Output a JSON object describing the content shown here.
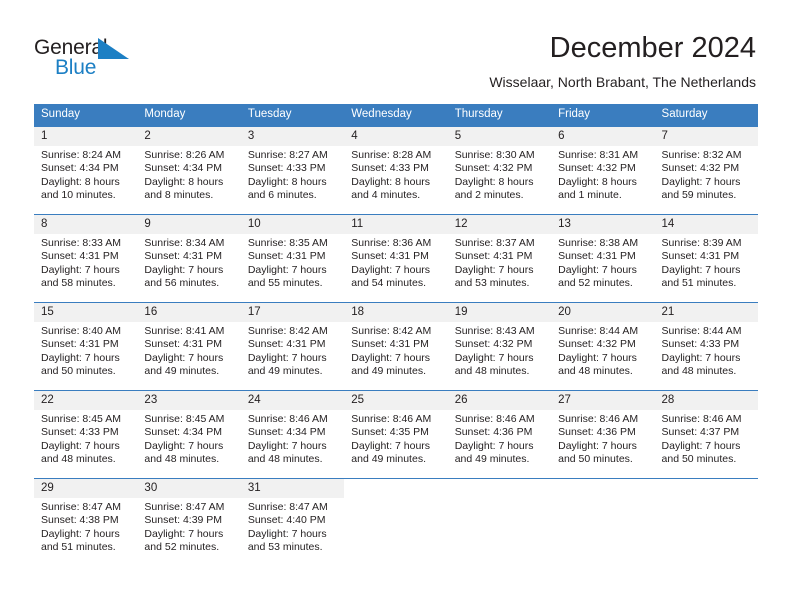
{
  "brand": {
    "name_part1": "General",
    "name_part2": "Blue",
    "mark": "triangle-logo-icon",
    "color_dark": "#231f20",
    "color_blue": "#1c7fc4"
  },
  "header": {
    "title": "December 2024",
    "subtitle": "Wisselaar, North Brabant, The Netherlands"
  },
  "theme": {
    "header_row_bg": "#3a7dbf",
    "header_row_text": "#ffffff",
    "daynum_bg": "#f1f1f1",
    "cell_bg": "#ffffff",
    "rule_color": "#3a7dbf"
  },
  "columns": [
    "Sunday",
    "Monday",
    "Tuesday",
    "Wednesday",
    "Thursday",
    "Friday",
    "Saturday"
  ],
  "weeks": [
    [
      {
        "day": "1",
        "sunrise": "Sunrise: 8:24 AM",
        "sunset": "Sunset: 4:34 PM",
        "daylight": "Daylight: 8 hours and 10 minutes."
      },
      {
        "day": "2",
        "sunrise": "Sunrise: 8:26 AM",
        "sunset": "Sunset: 4:34 PM",
        "daylight": "Daylight: 8 hours and 8 minutes."
      },
      {
        "day": "3",
        "sunrise": "Sunrise: 8:27 AM",
        "sunset": "Sunset: 4:33 PM",
        "daylight": "Daylight: 8 hours and 6 minutes."
      },
      {
        "day": "4",
        "sunrise": "Sunrise: 8:28 AM",
        "sunset": "Sunset: 4:33 PM",
        "daylight": "Daylight: 8 hours and 4 minutes."
      },
      {
        "day": "5",
        "sunrise": "Sunrise: 8:30 AM",
        "sunset": "Sunset: 4:32 PM",
        "daylight": "Daylight: 8 hours and 2 minutes."
      },
      {
        "day": "6",
        "sunrise": "Sunrise: 8:31 AM",
        "sunset": "Sunset: 4:32 PM",
        "daylight": "Daylight: 8 hours and 1 minute."
      },
      {
        "day": "7",
        "sunrise": "Sunrise: 8:32 AM",
        "sunset": "Sunset: 4:32 PM",
        "daylight": "Daylight: 7 hours and 59 minutes."
      }
    ],
    [
      {
        "day": "8",
        "sunrise": "Sunrise: 8:33 AM",
        "sunset": "Sunset: 4:31 PM",
        "daylight": "Daylight: 7 hours and 58 minutes."
      },
      {
        "day": "9",
        "sunrise": "Sunrise: 8:34 AM",
        "sunset": "Sunset: 4:31 PM",
        "daylight": "Daylight: 7 hours and 56 minutes."
      },
      {
        "day": "10",
        "sunrise": "Sunrise: 8:35 AM",
        "sunset": "Sunset: 4:31 PM",
        "daylight": "Daylight: 7 hours and 55 minutes."
      },
      {
        "day": "11",
        "sunrise": "Sunrise: 8:36 AM",
        "sunset": "Sunset: 4:31 PM",
        "daylight": "Daylight: 7 hours and 54 minutes."
      },
      {
        "day": "12",
        "sunrise": "Sunrise: 8:37 AM",
        "sunset": "Sunset: 4:31 PM",
        "daylight": "Daylight: 7 hours and 53 minutes."
      },
      {
        "day": "13",
        "sunrise": "Sunrise: 8:38 AM",
        "sunset": "Sunset: 4:31 PM",
        "daylight": "Daylight: 7 hours and 52 minutes."
      },
      {
        "day": "14",
        "sunrise": "Sunrise: 8:39 AM",
        "sunset": "Sunset: 4:31 PM",
        "daylight": "Daylight: 7 hours and 51 minutes."
      }
    ],
    [
      {
        "day": "15",
        "sunrise": "Sunrise: 8:40 AM",
        "sunset": "Sunset: 4:31 PM",
        "daylight": "Daylight: 7 hours and 50 minutes."
      },
      {
        "day": "16",
        "sunrise": "Sunrise: 8:41 AM",
        "sunset": "Sunset: 4:31 PM",
        "daylight": "Daylight: 7 hours and 49 minutes."
      },
      {
        "day": "17",
        "sunrise": "Sunrise: 8:42 AM",
        "sunset": "Sunset: 4:31 PM",
        "daylight": "Daylight: 7 hours and 49 minutes."
      },
      {
        "day": "18",
        "sunrise": "Sunrise: 8:42 AM",
        "sunset": "Sunset: 4:31 PM",
        "daylight": "Daylight: 7 hours and 49 minutes."
      },
      {
        "day": "19",
        "sunrise": "Sunrise: 8:43 AM",
        "sunset": "Sunset: 4:32 PM",
        "daylight": "Daylight: 7 hours and 48 minutes."
      },
      {
        "day": "20",
        "sunrise": "Sunrise: 8:44 AM",
        "sunset": "Sunset: 4:32 PM",
        "daylight": "Daylight: 7 hours and 48 minutes."
      },
      {
        "day": "21",
        "sunrise": "Sunrise: 8:44 AM",
        "sunset": "Sunset: 4:33 PM",
        "daylight": "Daylight: 7 hours and 48 minutes."
      }
    ],
    [
      {
        "day": "22",
        "sunrise": "Sunrise: 8:45 AM",
        "sunset": "Sunset: 4:33 PM",
        "daylight": "Daylight: 7 hours and 48 minutes."
      },
      {
        "day": "23",
        "sunrise": "Sunrise: 8:45 AM",
        "sunset": "Sunset: 4:34 PM",
        "daylight": "Daylight: 7 hours and 48 minutes."
      },
      {
        "day": "24",
        "sunrise": "Sunrise: 8:46 AM",
        "sunset": "Sunset: 4:34 PM",
        "daylight": "Daylight: 7 hours and 48 minutes."
      },
      {
        "day": "25",
        "sunrise": "Sunrise: 8:46 AM",
        "sunset": "Sunset: 4:35 PM",
        "daylight": "Daylight: 7 hours and 49 minutes."
      },
      {
        "day": "26",
        "sunrise": "Sunrise: 8:46 AM",
        "sunset": "Sunset: 4:36 PM",
        "daylight": "Daylight: 7 hours and 49 minutes."
      },
      {
        "day": "27",
        "sunrise": "Sunrise: 8:46 AM",
        "sunset": "Sunset: 4:36 PM",
        "daylight": "Daylight: 7 hours and 50 minutes."
      },
      {
        "day": "28",
        "sunrise": "Sunrise: 8:46 AM",
        "sunset": "Sunset: 4:37 PM",
        "daylight": "Daylight: 7 hours and 50 minutes."
      }
    ],
    [
      {
        "day": "29",
        "sunrise": "Sunrise: 8:47 AM",
        "sunset": "Sunset: 4:38 PM",
        "daylight": "Daylight: 7 hours and 51 minutes."
      },
      {
        "day": "30",
        "sunrise": "Sunrise: 8:47 AM",
        "sunset": "Sunset: 4:39 PM",
        "daylight": "Daylight: 7 hours and 52 minutes."
      },
      {
        "day": "31",
        "sunrise": "Sunrise: 8:47 AM",
        "sunset": "Sunset: 4:40 PM",
        "daylight": "Daylight: 7 hours and 53 minutes."
      },
      {
        "day": "",
        "sunrise": "",
        "sunset": "",
        "daylight": ""
      },
      {
        "day": "",
        "sunrise": "",
        "sunset": "",
        "daylight": ""
      },
      {
        "day": "",
        "sunrise": "",
        "sunset": "",
        "daylight": ""
      },
      {
        "day": "",
        "sunrise": "",
        "sunset": "",
        "daylight": ""
      }
    ]
  ]
}
